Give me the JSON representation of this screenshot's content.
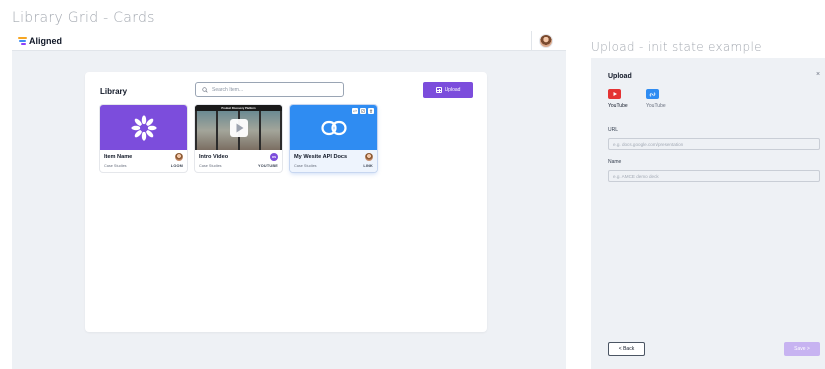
{
  "frames": {
    "left_label": "Library Grid - Cards",
    "right_label": "Upload - init state example"
  },
  "app": {
    "logo_text": "Aligned"
  },
  "library": {
    "title": "Library",
    "search_placeholder": "Search Item...",
    "upload_label": "Upload",
    "cards": [
      {
        "name": "Item Name",
        "category": "Case Studies",
        "type": "LOOM",
        "thumb_icon": "loom-icon"
      },
      {
        "name": "Intro Video",
        "category": "Case Studies",
        "type": "YOUTUBE",
        "thumb_title": "Product Discovery Platform",
        "avatar_initials": "OS"
      },
      {
        "name": "My Wesite API Docs",
        "category": "Case Studies",
        "type": "LINK",
        "thumb_icon": "link-icon"
      }
    ]
  },
  "upload": {
    "title": "Upload",
    "sources": [
      {
        "label": "YouTube",
        "icon": "youtube-icon"
      },
      {
        "label": "YouTube",
        "icon": "link-icon"
      }
    ],
    "url_label": "URL",
    "url_placeholder": "e.g. docs.google.com/presentation",
    "name_label": "Name",
    "name_placeholder": "e.g. AMCE demo deck",
    "back_label": "< Back",
    "save_label": "Save >"
  },
  "colors": {
    "brand_purple": "#7c4ddc",
    "link_blue": "#2f8cf2",
    "youtube_red": "#e43333"
  }
}
